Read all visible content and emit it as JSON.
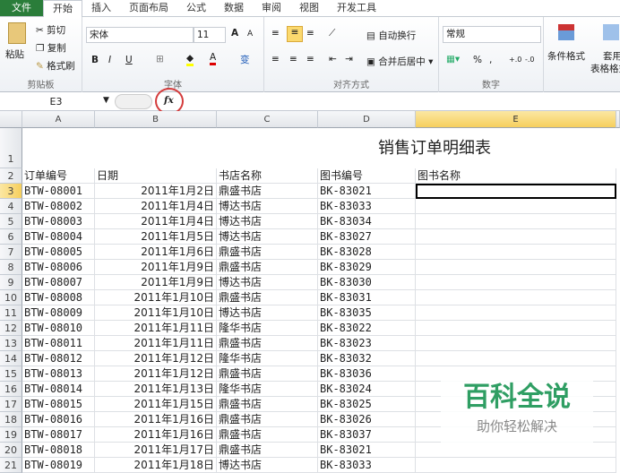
{
  "tabs": [
    "文件",
    "开始",
    "插入",
    "页面布局",
    "公式",
    "数据",
    "审阅",
    "视图",
    "开发工具"
  ],
  "clipboard": {
    "paste": "粘贴",
    "cut": "剪切",
    "copy": "复制",
    "format_painter": "格式刷",
    "label": "剪贴板"
  },
  "font": {
    "name": "宋体",
    "size": "11",
    "bold": "B",
    "italic": "I",
    "underline": "U",
    "label": "字体",
    "grow": "A",
    "shrink": "A",
    "font_color": "A",
    "phonetic": "变"
  },
  "alignment": {
    "wrap": "自动换行",
    "merge": "合并后居中",
    "label": "对齐方式"
  },
  "number": {
    "format": "常规",
    "percent": "%",
    "comma": ",",
    "inc_dec": "+.0",
    "dec_dec": "-.0",
    "label": "数字"
  },
  "styles": {
    "conditional": "条件格式",
    "table_format_1": "套用",
    "table_format_2": "表格格式"
  },
  "formula_bar": {
    "name_box": "E3",
    "fx": "fx",
    "value": ""
  },
  "columns": [
    "A",
    "B",
    "C",
    "D",
    "E"
  ],
  "sheet": {
    "title": "销售订单明细表",
    "headers": [
      "订单编号",
      "日期",
      "书店名称",
      "图书编号",
      "图书名称"
    ],
    "rows": [
      [
        "BTW-08001",
        "2011年1月2日",
        "鼎盛书店",
        "BK-83021"
      ],
      [
        "BTW-08002",
        "2011年1月4日",
        "博达书店",
        "BK-83033"
      ],
      [
        "BTW-08003",
        "2011年1月4日",
        "博达书店",
        "BK-83034"
      ],
      [
        "BTW-08004",
        "2011年1月5日",
        "博达书店",
        "BK-83027"
      ],
      [
        "BTW-08005",
        "2011年1月6日",
        "鼎盛书店",
        "BK-83028"
      ],
      [
        "BTW-08006",
        "2011年1月9日",
        "鼎盛书店",
        "BK-83029"
      ],
      [
        "BTW-08007",
        "2011年1月9日",
        "博达书店",
        "BK-83030"
      ],
      [
        "BTW-08008",
        "2011年1月10日",
        "鼎盛书店",
        "BK-83031"
      ],
      [
        "BTW-08009",
        "2011年1月10日",
        "博达书店",
        "BK-83035"
      ],
      [
        "BTW-08010",
        "2011年1月11日",
        "隆华书店",
        "BK-83022"
      ],
      [
        "BTW-08011",
        "2011年1月11日",
        "鼎盛书店",
        "BK-83023"
      ],
      [
        "BTW-08012",
        "2011年1月12日",
        "隆华书店",
        "BK-83032"
      ],
      [
        "BTW-08013",
        "2011年1月12日",
        "鼎盛书店",
        "BK-83036"
      ],
      [
        "BTW-08014",
        "2011年1月13日",
        "隆华书店",
        "BK-83024"
      ],
      [
        "BTW-08015",
        "2011年1月15日",
        "鼎盛书店",
        "BK-83025"
      ],
      [
        "BTW-08016",
        "2011年1月16日",
        "鼎盛书店",
        "BK-83026"
      ],
      [
        "BTW-08017",
        "2011年1月16日",
        "鼎盛书店",
        "BK-83037"
      ],
      [
        "BTW-08018",
        "2011年1月17日",
        "鼎盛书店",
        "BK-83021"
      ],
      [
        "BTW-08019",
        "2011年1月18日",
        "博达书店",
        "BK-83033"
      ]
    ]
  },
  "watermark": {
    "title": "百科全说",
    "subtitle": "助你轻松解决"
  }
}
